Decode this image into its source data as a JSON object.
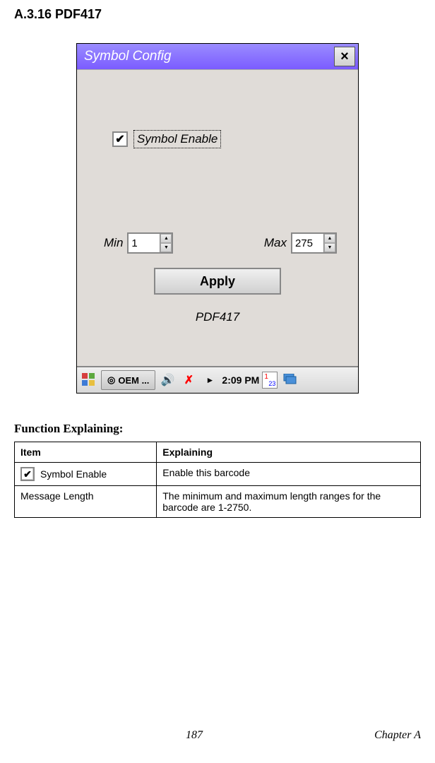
{
  "section": {
    "heading": "A.3.16  PDF417"
  },
  "window": {
    "title": "Symbol Config",
    "close_label": "×",
    "checkbox": {
      "checked": true,
      "label": "Symbol Enable"
    },
    "fields": {
      "min_label": "Min",
      "min_value": "1",
      "max_label": "Max",
      "max_value": "275"
    },
    "apply_label": "Apply",
    "barcode_name": "PDF417"
  },
  "taskbar": {
    "task_label": "OEM ...",
    "time_prefix": "►",
    "time": "2:09 PM"
  },
  "explain": {
    "heading": "Function Explaining:",
    "headers": {
      "item": "Item",
      "explaining": "Explaining"
    },
    "rows": [
      {
        "item": "Symbol Enable",
        "text": "Enable this barcode",
        "has_icon": true
      },
      {
        "item": "Message Length",
        "text": "The minimum and maximum length ranges for the barcode are 1-2750.",
        "has_icon": false
      }
    ]
  },
  "footer": {
    "page": "187",
    "chapter": "Chapter A"
  }
}
